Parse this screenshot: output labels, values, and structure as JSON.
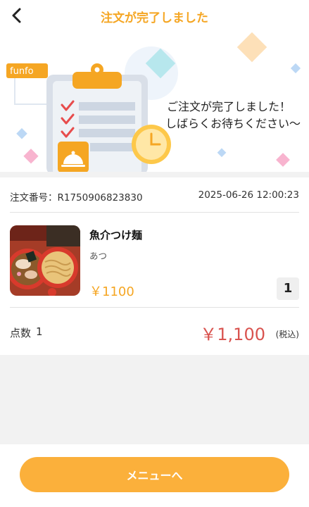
{
  "header": {
    "title": "注文が完了しました"
  },
  "hero": {
    "logo_text": "funfo",
    "line1": "ご注文が完了しました！",
    "line2": "しばらくお待ちください〜"
  },
  "order": {
    "number": "注文番号：R1750906823830",
    "datetime": "2025-06-26 12:00:23",
    "item": {
      "name": "魚介つけ麺",
      "option": "あつ",
      "price": "￥1100",
      "quantity": "1"
    },
    "summary": {
      "count_label": "点数",
      "count_value": "1",
      "total": "￥1,100",
      "tax_note": "(税込)"
    }
  },
  "footer": {
    "button_label": "メニューへ"
  },
  "colors": {
    "accent": "#f5a623",
    "button": "#fbb03b",
    "total": "#d9534f"
  },
  "icons": [
    "back-arrow-icon",
    "clipboard-checklist-icon",
    "clock-icon",
    "food-cloche-icon"
  ]
}
